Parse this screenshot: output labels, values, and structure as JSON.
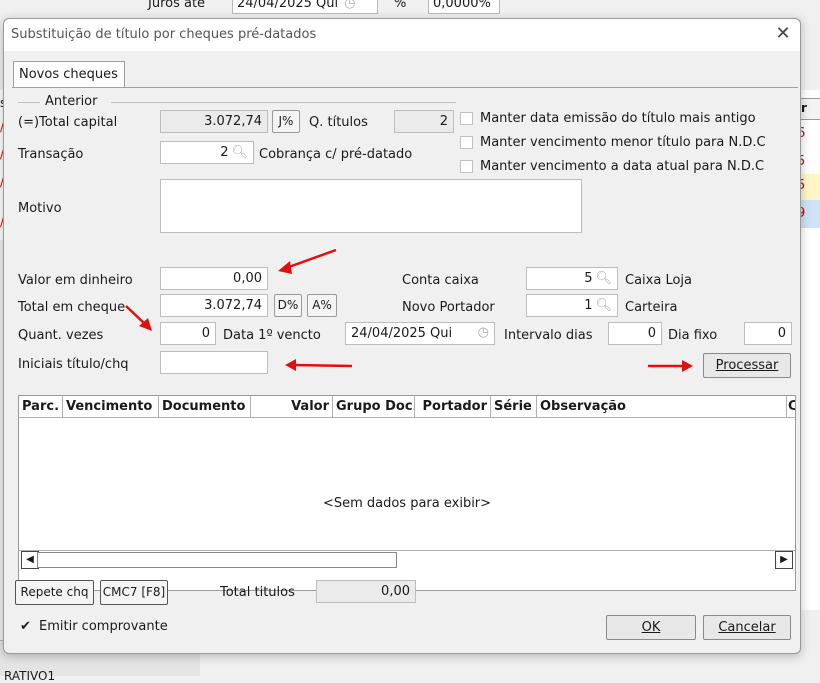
{
  "background": {
    "top_label": "Juros até",
    "top_date": "24/04/2025 Qui",
    "top_percent_sign": "%",
    "top_percent_value": "0,0000%",
    "right_header": "r",
    "right_values": [
      "6",
      "5",
      "5",
      "9"
    ],
    "bottom_text": "RATIVO1"
  },
  "dialog": {
    "title": "Substituição de título por cheques pré-datados",
    "tab_label": "Novos cheques",
    "group_label": "Anterior",
    "total_capital_label": "(=)Total capital",
    "total_capital_value": "3.072,74",
    "j_percent_button": "J%",
    "q_titulos_label": "Q. títulos",
    "q_titulos_value": "2",
    "checkbox_1": "Manter data emissão do título mais antigo",
    "checkbox_2": "Manter vencimento menor título para N.D.C",
    "checkbox_3": "Manter vencimento a data atual para N.D.C",
    "transacao_label": "Transação",
    "transacao_value": "2",
    "transacao_desc": "Cobrança c/ pré-datado",
    "motivo_label": "Motivo",
    "valor_dinheiro_label": "Valor em dinheiro",
    "valor_dinheiro_value": "0,00",
    "conta_caixa_label": "Conta caixa",
    "conta_caixa_value": "5",
    "conta_caixa_desc": "Caixa Loja",
    "total_cheque_label": "Total em cheque",
    "total_cheque_value": "3.072,74",
    "d_percent_button": "D%",
    "a_percent_button": "A%",
    "novo_portador_label": "Novo Portador",
    "novo_portador_value": "1",
    "novo_portador_desc": "Carteira",
    "quant_vezes_label": "Quant. vezes",
    "quant_vezes_value": "0",
    "data_vencto_label": "Data 1º vencto",
    "data_vencto_value": "24/04/2025 Qui",
    "intervalo_label": "Intervalo dias",
    "intervalo_value": "0",
    "dia_fixo_label": "Dia fixo",
    "dia_fixo_value": "0",
    "iniciais_label": "Iniciais título/chq",
    "processar_button": "Processar",
    "grid_columns": [
      "Parc.",
      "Vencimento",
      "Documento",
      "Valor",
      "Grupo Doc.",
      "Portador",
      "Série",
      "Observação",
      "C"
    ],
    "grid_empty": "<Sem dados para exibir>",
    "repete_button": "Repete chq",
    "cmc7_button": "CMC7 [F8]",
    "total_titulos_label": "Total titulos",
    "total_titulos_value": "0,00",
    "emitir_label": "Emitir comprovante",
    "ok_button": "OK",
    "cancelar_button": "Cancelar"
  },
  "colors": {
    "annotation_arrow": "#e01010",
    "highlight_row_yellow": "#fff6c8",
    "highlight_row_blue": "#cfe3f7",
    "value_red": "#d40000"
  }
}
